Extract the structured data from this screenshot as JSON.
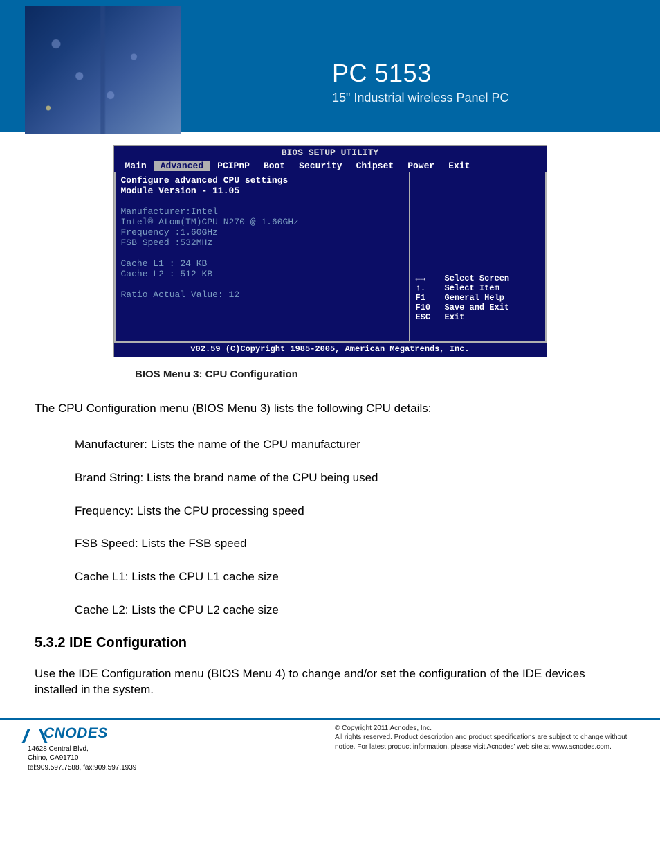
{
  "header": {
    "product": "PC 5153",
    "subtitle": "15\" Industrial wireless Panel PC"
  },
  "bios": {
    "title": "BIOS SETUP UTILITY",
    "tabs": [
      "Main",
      "Advanced",
      "PCIPnP",
      "Boot",
      "Security",
      "Chipset",
      "Power",
      "Exit"
    ],
    "active_tab": "Advanced",
    "left_lines": {
      "l1": "Configure advanced CPU settings",
      "l2": "Module Version - 11.05",
      "l3": "Manufacturer:Intel",
      "l4": "Intel® Atom(TM)CPU N270 @ 1.60GHz",
      "l5": "Frequency   :1.60GHz",
      "l6": "FSB Speed   :532MHz",
      "l7": "Cache L1    : 24 KB",
      "l8": "Cache L2    : 512 KB",
      "l9": "Ratio Actual Value: 12"
    },
    "help": [
      {
        "key": "←→",
        "txt": "Select Screen"
      },
      {
        "key": "↑↓",
        "txt": "Select Item"
      },
      {
        "key": "F1",
        "txt": "General Help"
      },
      {
        "key": "F10",
        "txt": "Save and Exit"
      },
      {
        "key": "ESC",
        "txt": "Exit"
      }
    ],
    "copyright": "v02.59 (C)Copyright 1985-2005, American Megatrends, Inc.",
    "caption": "BIOS Menu 3: CPU Configuration"
  },
  "body": {
    "intro": "The CPU Configuration menu (BIOS Menu 3) lists the following CPU details:",
    "bullets": {
      "b1": "Manufacturer: Lists the name of the CPU manufacturer",
      "b2": "Brand String: Lists the brand name of the CPU being used",
      "b3": "Frequency: Lists the CPU processing speed",
      "b4": "FSB Speed: Lists the FSB speed",
      "b5": "Cache L1: Lists the CPU L1 cache size",
      "b6": "Cache L2: Lists the CPU L2 cache size"
    },
    "section_heading": "5.3.2 IDE Configuration",
    "section_body": "Use the IDE Configuration menu (BIOS Menu 4) to change and/or set the configuration of the IDE devices installed in the system."
  },
  "footer": {
    "logo_text": "CNODES",
    "addr1": "14628 Central Blvd,",
    "addr2": "Chino, CA91710",
    "addr3": "tel:909.597.7588, fax:909.597.1939",
    "copy": "© Copyright 2011 Acnodes, Inc.",
    "notice": "All rights reserved. Product description and product specifications are subject to change without notice. For latest product information, please visit Acnodes' web site at www.acnodes.com."
  }
}
